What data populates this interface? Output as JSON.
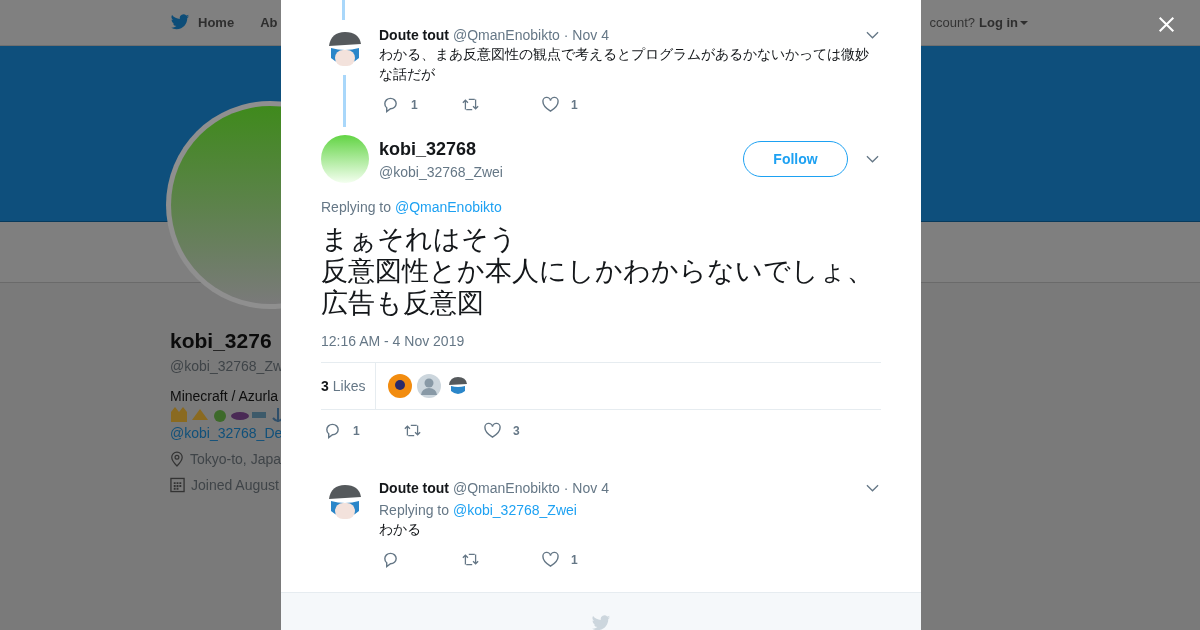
{
  "nav": {
    "items": [
      "Home",
      "Ab"
    ],
    "login_prompt": "ccount?",
    "login": "Log in"
  },
  "profile": {
    "name": "kobi_3276",
    "handle": "@kobi_32768_Zw",
    "bio": "Minecraft / Azurla",
    "bio_link": "@kobi_32768_De",
    "location": "Tokyo-to, Japa",
    "joined": "Joined August"
  },
  "parent": {
    "author": "Doute tout",
    "handle": "@QmanEnobikto",
    "date": "· Nov 4",
    "text": "わかる、まあ反意図性の観点で考えるとプログラムがあるかないかっては微妙な話だが",
    "actions": [
      {
        "kind": "reply",
        "count": "1"
      },
      {
        "kind": "retweet"
      },
      {
        "kind": "like",
        "count": "1"
      }
    ]
  },
  "main": {
    "author": "kobi_32768",
    "handle": "@kobi_32768_Zwei",
    "follow": "Follow",
    "replying_label": "Replying to",
    "replying_to": "@QmanEnobikto",
    "lines": [
      "まぁそれはそう",
      "反意図性とか本人にしかわからないでしょ、",
      "広告も反意図"
    ],
    "time": "12:16 AM - 4 Nov 2019",
    "likes_count": "3",
    "likes_label": "Likes",
    "likers": [
      {
        "kind": "orange"
      },
      {
        "kind": "default"
      },
      {
        "kind": "character"
      }
    ],
    "actions": [
      {
        "kind": "reply",
        "count": "1"
      },
      {
        "kind": "retweet"
      },
      {
        "kind": "like",
        "count": "3"
      }
    ]
  },
  "replies": [
    {
      "author": "Doute tout",
      "handle": "@QmanEnobikto",
      "date": "· Nov 4",
      "replying_label": "Replying to",
      "replying_to": "@kobi_32768_Zwei",
      "text": "わかる",
      "actions": [
        {
          "kind": "reply"
        },
        {
          "kind": "retweet"
        },
        {
          "kind": "like",
          "count": "1"
        }
      ]
    }
  ]
}
